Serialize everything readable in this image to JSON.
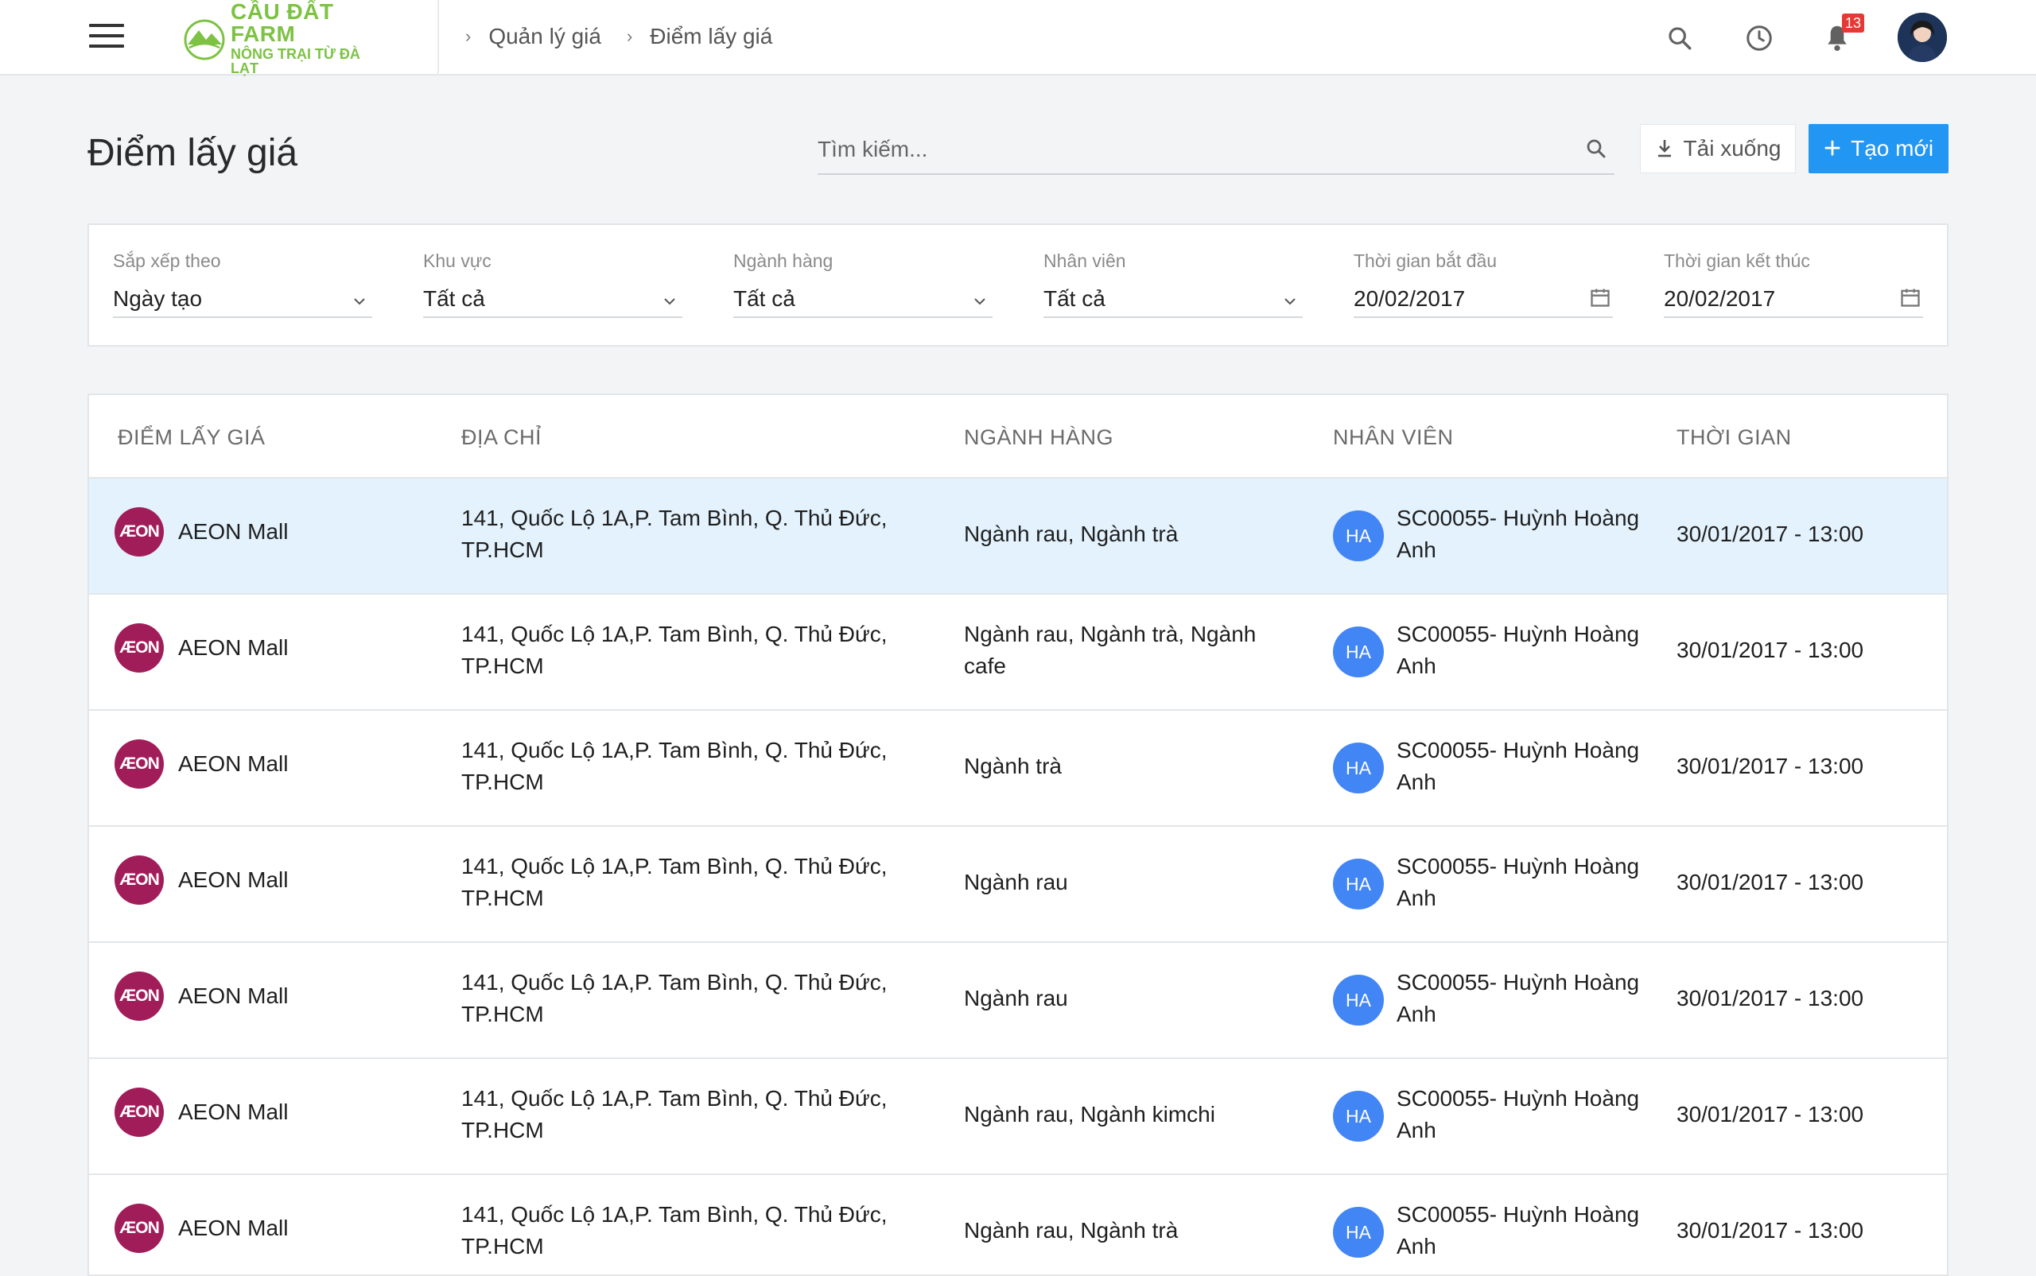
{
  "header": {
    "logo": {
      "name": "CẦU ĐẤT FARM",
      "tagline": "NÔNG TRẠI TỪ ĐÀ LẠT"
    },
    "breadcrumb": [
      "Quản lý giá",
      "Điểm lấy giá"
    ],
    "notification_count": "13",
    "icons": [
      "menu-icon",
      "search-icon",
      "clock-icon",
      "bell-icon"
    ]
  },
  "page": {
    "title": "Điểm lấy giá",
    "search_placeholder": "Tìm kiếm...",
    "download_label": "Tải xuống",
    "create_label": "Tạo mới"
  },
  "filters": [
    {
      "label": "Sắp xếp theo",
      "value": "Ngày tạo",
      "type": "select"
    },
    {
      "label": "Khu vực",
      "value": "Tất cả",
      "type": "select"
    },
    {
      "label": "Ngành hàng",
      "value": "Tất cả",
      "type": "select"
    },
    {
      "label": "Nhân viên",
      "value": "Tất cả",
      "type": "select"
    },
    {
      "label": "Thời gian bắt đầu",
      "value": "20/02/2017",
      "type": "date"
    },
    {
      "label": "Thời gian kết thúc",
      "value": "20/02/2017",
      "type": "date"
    }
  ],
  "table": {
    "columns": [
      "ĐIỂM LẤY GIÁ",
      "ĐỊA CHỈ",
      "NGÀNH HÀNG",
      "NHÂN VIÊN",
      "THỜI GIAN"
    ],
    "rows": [
      {
        "store": "AEON Mall",
        "logo_text": "ÆON",
        "address": [
          "141, Quốc Lộ 1A,P. Tam Bình, Q. Thủ Đức,",
          "TP.HCM"
        ],
        "category": [
          "Ngành rau, Ngành trà"
        ],
        "employee_initials": "HA",
        "employee": [
          "SC00055- Huỳnh Hoàng",
          "Anh"
        ],
        "time": "30/01/2017 - 13:00",
        "selected": true
      },
      {
        "store": "AEON Mall",
        "logo_text": "ÆON",
        "address": [
          "141, Quốc Lộ 1A,P. Tam Bình, Q. Thủ Đức,",
          "TP.HCM"
        ],
        "category": [
          "Ngành rau, Ngành trà, Ngành",
          "cafe"
        ],
        "employee_initials": "HA",
        "employee": [
          "SC00055- Huỳnh Hoàng",
          "Anh"
        ],
        "time": "30/01/2017 - 13:00",
        "selected": false
      },
      {
        "store": "AEON Mall",
        "logo_text": "ÆON",
        "address": [
          "141, Quốc Lộ 1A,P. Tam Bình, Q. Thủ Đức,",
          "TP.HCM"
        ],
        "category": [
          "Ngành trà"
        ],
        "employee_initials": "HA",
        "employee": [
          "SC00055- Huỳnh Hoàng",
          "Anh"
        ],
        "time": "30/01/2017 - 13:00",
        "selected": false
      },
      {
        "store": "AEON Mall",
        "logo_text": "ÆON",
        "address": [
          "141, Quốc Lộ 1A,P. Tam Bình, Q. Thủ Đức,",
          "TP.HCM"
        ],
        "category": [
          "Ngành rau"
        ],
        "employee_initials": "HA",
        "employee": [
          "SC00055- Huỳnh Hoàng",
          "Anh"
        ],
        "time": "30/01/2017 - 13:00",
        "selected": false
      },
      {
        "store": "AEON Mall",
        "logo_text": "ÆON",
        "address": [
          "141, Quốc Lộ 1A,P. Tam Bình, Q. Thủ Đức,",
          "TP.HCM"
        ],
        "category": [
          "Ngành rau"
        ],
        "employee_initials": "HA",
        "employee": [
          "SC00055- Huỳnh Hoàng",
          "Anh"
        ],
        "time": "30/01/2017 - 13:00",
        "selected": false
      },
      {
        "store": "AEON Mall",
        "logo_text": "ÆON",
        "address": [
          "141, Quốc Lộ 1A,P. Tam Bình, Q. Thủ Đức,",
          "TP.HCM"
        ],
        "category": [
          "Ngành rau, Ngành kimchi"
        ],
        "employee_initials": "HA",
        "employee": [
          "SC00055- Huỳnh Hoàng",
          "Anh"
        ],
        "time": "30/01/2017 - 13:00",
        "selected": false
      },
      {
        "store": "AEON Mall",
        "logo_text": "ÆON",
        "address": [
          "141, Quốc Lộ 1A,P. Tam Bình, Q. Thủ Đức,",
          "TP.HCM"
        ],
        "category": [
          "Ngành rau, Ngành trà"
        ],
        "employee_initials": "HA",
        "employee": [
          "SC00055- Huỳnh Hoàng",
          "Anh"
        ],
        "time": "30/01/2017 - 13:00",
        "selected": false
      }
    ]
  },
  "colors": {
    "accent": "#2196f3",
    "brand_green": "#7dc243",
    "store_logo": "#a11d5a",
    "employee_avatar": "#4285f4",
    "selected_row": "#e3f2fd"
  }
}
